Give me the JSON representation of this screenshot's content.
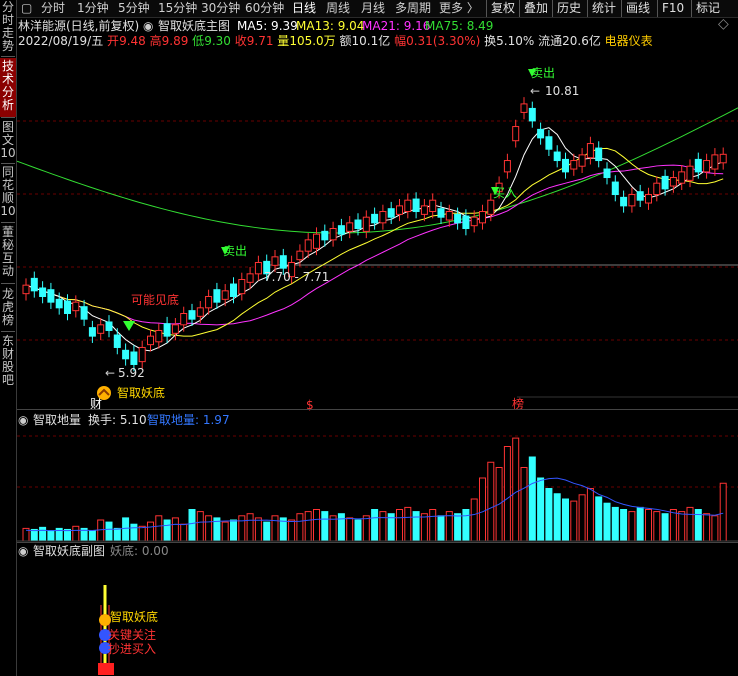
{
  "left_tabs": [
    {
      "label": "分时走势",
      "active": false
    },
    {
      "label": "技术分析",
      "active": true
    },
    {
      "label": "图文10",
      "active": false
    },
    {
      "label": "同花顺10",
      "active": false
    },
    {
      "label": "董秘互动",
      "active": false
    },
    {
      "label": "龙虎榜",
      "active": false
    },
    {
      "label": "东财股吧",
      "active": false
    }
  ],
  "period_tabs": [
    "分时",
    "1分钟",
    "5分钟",
    "15分钟",
    "30分钟",
    "60分钟",
    "日线",
    "周线",
    "月线",
    "多周期",
    "更多 〉"
  ],
  "active_period": "日线",
  "right_buttons": [
    "复权",
    "叠加",
    "历史",
    "统计",
    "画线",
    "F10",
    "标记"
  ],
  "dropdown_glyph": "⌄",
  "info": {
    "stock": "林洋能源(日线,前复权)",
    "indicator": "智取妖底主图",
    "ma": [
      {
        "label": "MA5: 9.39",
        "color": "#ffffff"
      },
      {
        "label": "MA13: 9.04",
        "color": "#ffff33"
      },
      {
        "label": "MA21: 9.16",
        "color": "#ff33ff"
      },
      {
        "label": "MA75: 8.49",
        "color": "#33dd33"
      }
    ],
    "date": "2022/08/19/五",
    "open_label": "开",
    "open": "9.48",
    "high_label": "高",
    "high": "9.89",
    "low_label": "低",
    "low": "9.30",
    "close_label": "收",
    "close": "9.71",
    "vol_label": "量",
    "vol": "105.0万",
    "amount_label": "额",
    "amount": "10.1亿",
    "range_label": "幅",
    "range": "0.31(3.30%)",
    "turnover_label": "换",
    "turnover": "5.10%",
    "float_label": "流通",
    "float": "20.6亿",
    "sector": "电器仪表"
  },
  "annotations": {
    "high_price": "10.81",
    "low_price": "5.92",
    "range_text": "7.70 - 7.71",
    "sell1": "卖出",
    "sell2": "卖出",
    "buy1": "买入",
    "maybe_bottom": "可能见底",
    "smart_bottom": "智取妖底",
    "marker_cai": "财",
    "marker_dollar": "$",
    "marker_bang": "榜"
  },
  "volume_panel": {
    "title": "智取地量",
    "turnover_label": "换手: 5.10",
    "indicator_label": "智取地量: 1.97"
  },
  "sub_panel": {
    "title": "智取妖底副图",
    "value_label": "妖底: 0.00",
    "tower_labels": [
      "智取妖底",
      "关键关注",
      "抄进买入"
    ]
  },
  "chart_data": [
    {
      "type": "candlestick",
      "title": "林洋能源(日线,前复权)",
      "series": [
        {
          "name": "MA5",
          "value": 9.39
        },
        {
          "name": "MA13",
          "value": 9.04
        },
        {
          "name": "MA21",
          "value": 9.16
        },
        {
          "name": "MA75",
          "value": 8.49
        }
      ],
      "last": {
        "open": 9.48,
        "high": 9.89,
        "low": 9.3,
        "close": 9.71
      },
      "annotated_high": 10.81,
      "annotated_low": 5.92
    },
    {
      "type": "bar",
      "title": "智取地量",
      "series": [
        {
          "name": "智取地量",
          "value": 1.97
        },
        {
          "name": "换手",
          "value": 5.1
        }
      ]
    },
    {
      "type": "bar",
      "title": "智取妖底副图",
      "series": [
        {
          "name": "妖底",
          "value": 0.0
        }
      ]
    }
  ],
  "colors": {
    "up": "#ff3333",
    "down": "#33ffff",
    "ma5": "#ffffff",
    "ma13": "#ffff33",
    "ma21": "#ff33ff",
    "ma75": "#33dd33",
    "grid": "#8a0000",
    "text_yellow": "#ffd700",
    "text_red": "#ff3333",
    "text_cyan": "#33ffff",
    "text_blue": "#3377ff"
  }
}
